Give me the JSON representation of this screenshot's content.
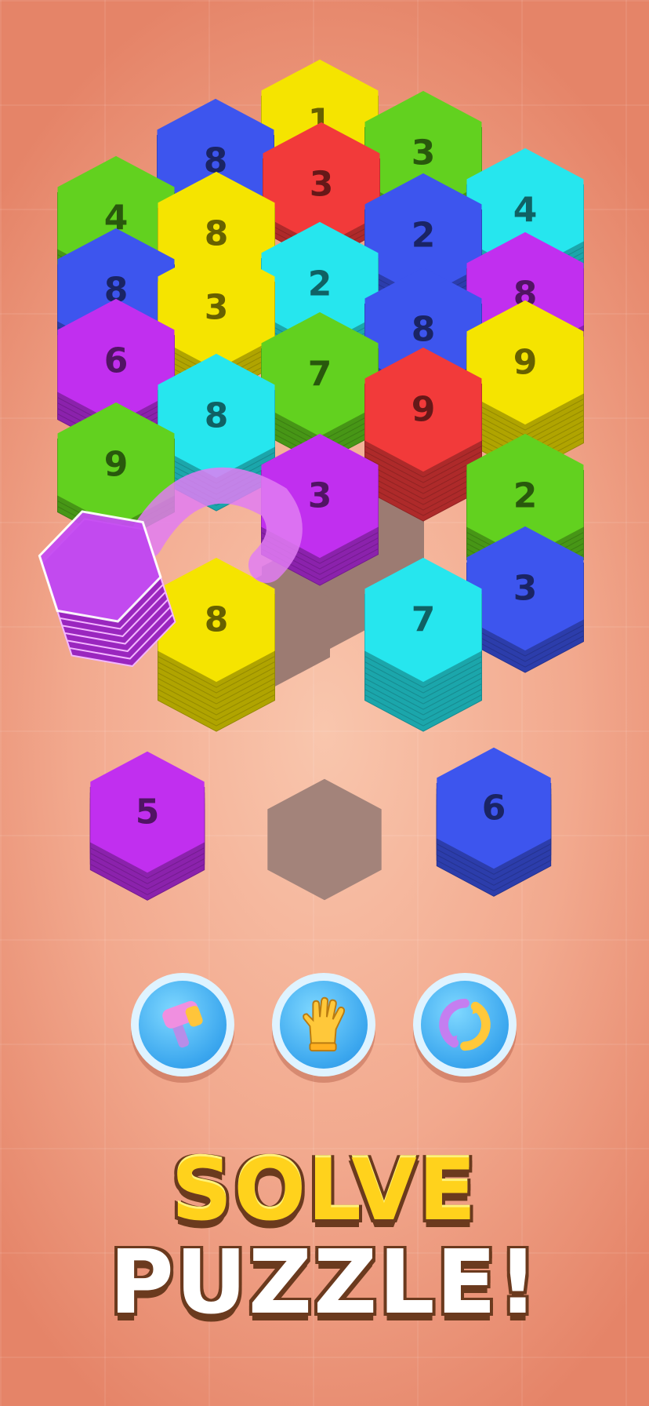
{
  "colors": {
    "yellow": "#f5e400",
    "green": "#62d11f",
    "blue": "#3d55ee",
    "red": "#f23a3a",
    "cyan": "#26e6ee",
    "purple": "#c12fef",
    "empty_slot": "#a3837a"
  },
  "board": {
    "stacks": [
      {
        "color": "yellow",
        "count": "1"
      },
      {
        "color": "blue",
        "count": "8"
      },
      {
        "color": "green",
        "count": "3"
      },
      {
        "color": "red",
        "count": "3"
      },
      {
        "color": "green",
        "count": "4"
      },
      {
        "color": "cyan",
        "count": "4"
      },
      {
        "color": "yellow",
        "count": "8"
      },
      {
        "color": "blue",
        "count": "2"
      },
      {
        "color": "blue",
        "count": "8"
      },
      {
        "color": "cyan",
        "count": "2"
      },
      {
        "color": "purple",
        "count": "8"
      },
      {
        "color": "yellow",
        "count": "3"
      },
      {
        "color": "blue",
        "count": "8"
      },
      {
        "color": "purple",
        "count": "6"
      },
      {
        "color": "green",
        "count": "7"
      },
      {
        "color": "yellow",
        "count": "9"
      },
      {
        "color": "cyan",
        "count": "8"
      },
      {
        "color": "red",
        "count": "9"
      },
      {
        "color": "green",
        "count": "9"
      },
      {
        "color": "purple",
        "count": "3"
      },
      {
        "color": "green",
        "count": "2"
      },
      {
        "color": "blue",
        "count": "3"
      },
      {
        "color": "yellow",
        "count": "8"
      },
      {
        "color": "cyan",
        "count": "7"
      }
    ],
    "moving_stack": {
      "color": "purple"
    }
  },
  "tray": {
    "slots": [
      {
        "color": "purple",
        "count": "5"
      },
      {
        "color": "empty",
        "count": ""
      },
      {
        "color": "blue",
        "count": "6"
      }
    ]
  },
  "boosters": [
    {
      "name": "hammer",
      "icon": "hammer-icon"
    },
    {
      "name": "hand",
      "icon": "glove-icon"
    },
    {
      "name": "shuffle",
      "icon": "refresh-icon"
    }
  ],
  "slogan": {
    "line1": "SOLVE",
    "line2": "PUZZLE!"
  }
}
